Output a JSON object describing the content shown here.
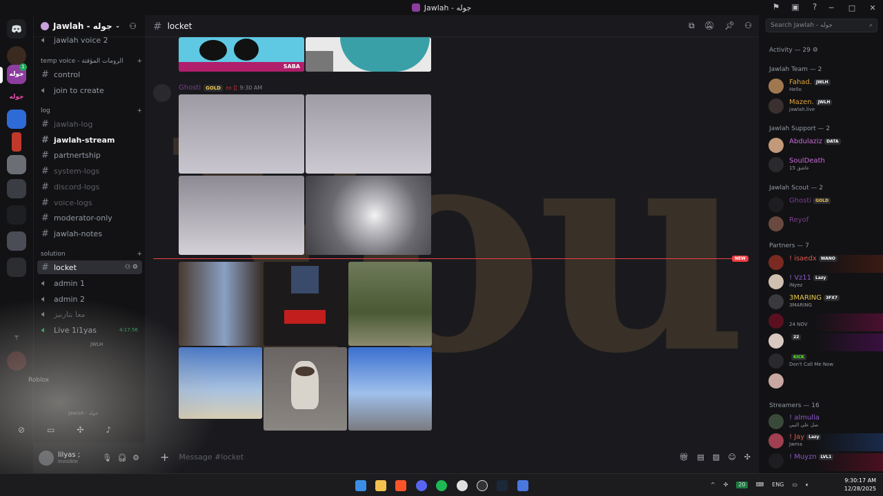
{
  "window": {
    "title": "Jawlah - جوله"
  },
  "server": {
    "name": "Jawlah - جوله"
  },
  "guild_labels": [
    "جوله",
    "جوله"
  ],
  "guild_badge": "1",
  "channels": {
    "top": {
      "label": "jawlah voice 2"
    },
    "cat_temp": {
      "label": "temp voice - الرومات المؤقتة"
    },
    "control": "control",
    "join": "join to create",
    "cat_log": {
      "label": "log"
    },
    "log_items": [
      "jawlah-log",
      "jawlah-stream",
      "partnertship",
      "system-logs",
      "discord-logs",
      "voice-logs",
      "moderator-only",
      "jawlah-notes"
    ],
    "cat_solution": {
      "label": "solution"
    },
    "locket": "locket",
    "admin1": "admin 1",
    "admin2": "admin 2",
    "muted_voice": "معا بتارنيز",
    "live": "Live 1i1yas",
    "live_time": "4:17:56",
    "live_tag": "JWLH",
    "roblox": "Roblox",
    "status_line": "Jawlah - جوله"
  },
  "user": {
    "name": "lilyas ;",
    "status": "Invisible"
  },
  "header": {
    "channel": "locket"
  },
  "search": {
    "placeholder": "Search Jawlah - جوله"
  },
  "message": {
    "author": "Ghosti",
    "tag": "GOLD",
    "time": "9:30 AM"
  },
  "first_image_label": "SABA",
  "new_label": "NEW",
  "overlay_text": "You",
  "composer": {
    "placeholder": "Message #locket"
  },
  "members": {
    "activity": "Activity — 29",
    "groups": [
      {
        "title": "Jawlah Team — 2",
        "items": [
          {
            "name": "Fahad.",
            "tag": "JWLH",
            "status": "Hello",
            "color": "#e0a33d"
          },
          {
            "name": "Mazen.",
            "tag": "JWLH",
            "status": "jawlah.live",
            "color": "#e0a33d"
          }
        ]
      },
      {
        "title": "Jawlah Support — 2",
        "items": [
          {
            "name": "Abdulaziz",
            "tag": "DATA",
            "status": "",
            "color": "#c86bd8"
          },
          {
            "name": "SoulDeath",
            "tag": "",
            "status": "عاشق 15",
            "color": "#c86bd8"
          }
        ]
      },
      {
        "title": "Jawlah Scout — 2",
        "items": [
          {
            "name": "Ghosti",
            "tag": "GOLD",
            "status": "",
            "color": "#7a3f8c"
          },
          {
            "name": "Reyof",
            "tag": "",
            "status": "",
            "color": "#7a3f8c"
          }
        ]
      },
      {
        "title": "Partners — 7",
        "items": [
          {
            "name": "! isaedx",
            "tag": "WANO",
            "status": "",
            "color": "#e0574f"
          },
          {
            "name": "! Vz11",
            "tag": "Lazy",
            "status": "iNyez",
            "color": "#8b58c9"
          },
          {
            "name": "3MARING",
            "tag": "3FX7",
            "status": "3MARING",
            "color": "#e6c84a"
          },
          {
            "name": "",
            "tag": "",
            "status": "24 NOV",
            "color": "#8b58c9"
          },
          {
            "name": "",
            "tag": "22",
            "status": "",
            "color": "#8b58c9"
          },
          {
            "name": "",
            "tag": "KICK",
            "status": "Don't Call Me Now",
            "color": "#8b58c9"
          },
          {
            "name": "",
            "tag": "",
            "status": "",
            "color": "#8b58c9"
          }
        ]
      },
      {
        "title": "Streamers — 16",
        "items": [
          {
            "name": "! almulla",
            "tag": "",
            "status": "صل على النبي",
            "color": "#8b58c9"
          },
          {
            "name": "! Jay",
            "tag": "Lazy",
            "status": "Jwma",
            "color": "#e0574f"
          },
          {
            "name": "! Muyzn",
            "tag": "LVL1",
            "status": "",
            "color": "#8b58c9"
          }
        ]
      }
    ]
  },
  "taskbar": {
    "lang": "ENG",
    "time": "9:30:17 AM",
    "date": "12/28/2025",
    "badge": "20"
  }
}
